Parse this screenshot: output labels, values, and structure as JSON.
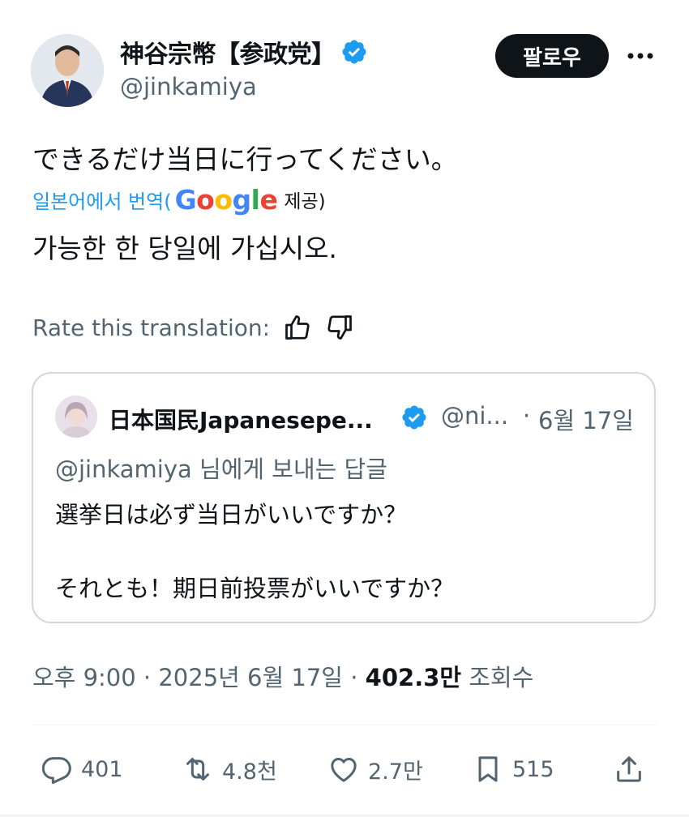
{
  "author": {
    "display_name": "神谷宗幣【参政党】",
    "handle": "@jinkamiya",
    "verified": true
  },
  "follow_button": {
    "label": "팔로우"
  },
  "more_button": {
    "icon": "more-horizontal-icon"
  },
  "tweet": {
    "text": "できるだけ当日に行ってください。",
    "translation": {
      "label": "일본어에서 번역(",
      "provider": "Google",
      "provided_by": "제공)",
      "text": "가능한 한 당일에 가십시오."
    },
    "rate": {
      "label": "Rate this translation:",
      "like_icon": "thumbs-up-icon",
      "dislike_icon": "thumbs-down-icon"
    }
  },
  "quote": {
    "display_name": "日本国民Japanesepe...",
    "handle": "@ni...",
    "separator": "·",
    "date": "6월 17일",
    "reply_to_handle": "@jinkamiya",
    "reply_to_suffix": " 님에게 보내는 답글",
    "lines": [
      "選挙日は必ず当日がいいですか？",
      "それとも！期日前投票がいいですか？"
    ]
  },
  "meta": {
    "time": "오후 9:00",
    "sep": " · ",
    "date": "2025년 6월 17일",
    "views": "402.3만",
    "views_label": " 조회수"
  },
  "actions": {
    "replies": "401",
    "reposts": "4.8천",
    "likes": "2.7만",
    "bookmarks": "515"
  },
  "colors": {
    "accent": "#1d9bf0",
    "text": "#0f1419",
    "secondary": "#536471",
    "border": "#cfd9de"
  }
}
